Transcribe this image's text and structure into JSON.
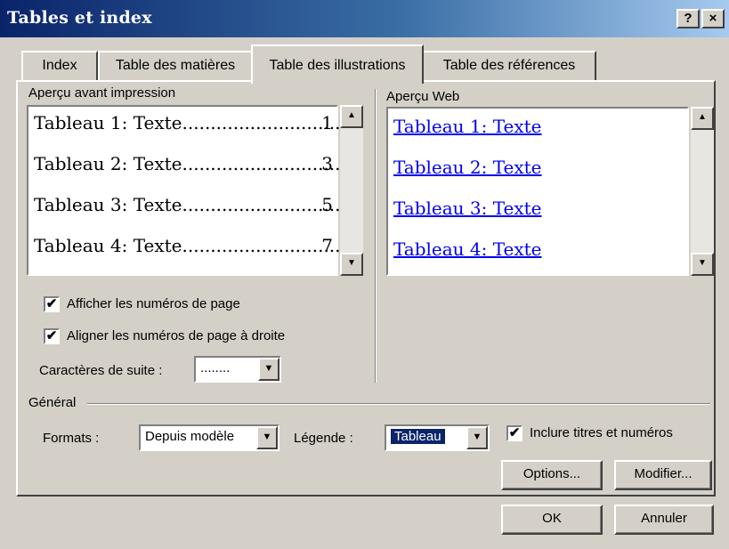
{
  "window": {
    "title": "Tables et index",
    "help_label": "?",
    "close_label": "×"
  },
  "tabs": [
    {
      "label": "Index"
    },
    {
      "label": "Table des matières"
    },
    {
      "label": "Table des illustrations",
      "active": true
    },
    {
      "label": "Table des références"
    }
  ],
  "print_preview": {
    "label": "Aperçu avant impression",
    "entries": [
      {
        "text": "Tableau 1: Texte",
        "dots": "............................",
        "page": "1"
      },
      {
        "text": "Tableau 2: Texte",
        "dots": "............................",
        "page": "3"
      },
      {
        "text": "Tableau 3: Texte",
        "dots": "............................",
        "page": "5"
      },
      {
        "text": "Tableau 4: Texte",
        "dots": "............................",
        "page": "7"
      }
    ]
  },
  "web_preview": {
    "label": "Aperçu Web",
    "links": [
      "Tableau 1: Texte",
      "Tableau 2: Texte",
      "Tableau 3: Texte",
      "Tableau 4: Texte"
    ]
  },
  "options": {
    "show_page_numbers": {
      "label": "Afficher les numéros de page",
      "checked": true
    },
    "align_right": {
      "label": "Aligner les numéros de page à droite",
      "checked": true
    },
    "leader": {
      "label": "Caractères de suite :",
      "value": "........"
    }
  },
  "general": {
    "label": "Général",
    "formats_label": "Formats :",
    "formats_value": "Depuis modèle",
    "caption_label": "Légende :",
    "caption_value": "Tableau",
    "include_label": "Inclure titres et numéros",
    "include_checked": true
  },
  "buttons": {
    "options": "Options...",
    "modify": "Modifier...",
    "ok": "OK",
    "cancel": "Annuler"
  },
  "icons": {
    "check": "✔",
    "arrow_up": "▲",
    "arrow_down": "▼"
  },
  "colors": {
    "title_start": "#0a246a",
    "title_end": "#a6caf0",
    "link": "#0000ee",
    "selection": "#0a246a"
  }
}
